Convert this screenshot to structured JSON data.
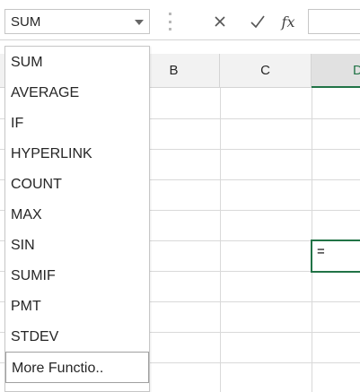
{
  "name_box": {
    "value": "SUM"
  },
  "formula_bar": {
    "cancel_icon": "close-icon",
    "enter_icon": "checkmark-icon",
    "fx_label": "fx",
    "value": ""
  },
  "columns": [
    "B",
    "C",
    "D"
  ],
  "active_column": "D",
  "active_cell": {
    "column": "D",
    "value": "="
  },
  "function_list": {
    "items": [
      "SUM",
      "AVERAGE",
      "IF",
      "HYPERLINK",
      "COUNT",
      "MAX",
      "SIN",
      "SUMIF",
      "PMT",
      "STDEV",
      "More Functio.."
    ]
  },
  "colors": {
    "accent": "#217346",
    "header_bg": "#f2f2f2",
    "gridline": "#d9d9d9"
  }
}
